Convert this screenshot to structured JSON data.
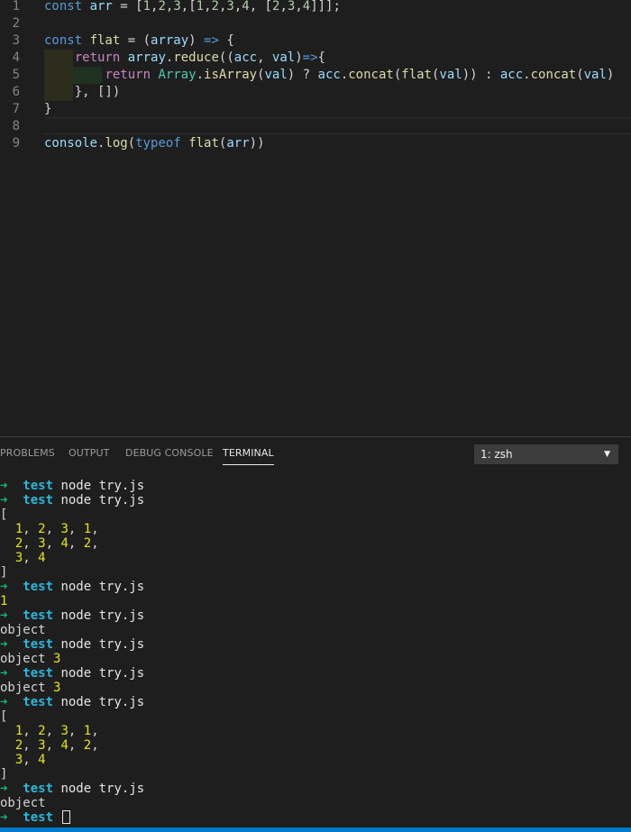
{
  "editor": {
    "lines": [
      {
        "num": "1",
        "tokens": [
          [
            "kw",
            "const "
          ],
          [
            "var",
            "arr"
          ],
          [
            "pl",
            " = ["
          ],
          [
            "num",
            "1"
          ],
          [
            "pl",
            ","
          ],
          [
            "num",
            "2"
          ],
          [
            "pl",
            ","
          ],
          [
            "num",
            "3"
          ],
          [
            "pl",
            ",["
          ],
          [
            "num",
            "1"
          ],
          [
            "pl",
            ","
          ],
          [
            "num",
            "2"
          ],
          [
            "pl",
            ","
          ],
          [
            "num",
            "3"
          ],
          [
            "pl",
            ","
          ],
          [
            "num",
            "4"
          ],
          [
            "pl",
            ", ["
          ],
          [
            "num",
            "2"
          ],
          [
            "pl",
            ","
          ],
          [
            "num",
            "3"
          ],
          [
            "pl",
            ","
          ],
          [
            "num",
            "4"
          ],
          [
            "pl",
            "]]];"
          ]
        ]
      },
      {
        "num": "2",
        "tokens": []
      },
      {
        "num": "3",
        "tokens": [
          [
            "kw",
            "const "
          ],
          [
            "fn",
            "flat"
          ],
          [
            "pl",
            " = ("
          ],
          [
            "var",
            "array"
          ],
          [
            "pl",
            ") "
          ],
          [
            "kw",
            "=>"
          ],
          [
            "pl",
            " {"
          ]
        ]
      },
      {
        "num": "4",
        "tokens": [
          [
            "pl",
            "    "
          ],
          [
            "ctl",
            "return "
          ],
          [
            "var",
            "array"
          ],
          [
            "pl",
            "."
          ],
          [
            "fn",
            "reduce"
          ],
          [
            "pl",
            "(("
          ],
          [
            "var",
            "acc"
          ],
          [
            "pl",
            ", "
          ],
          [
            "var",
            "val"
          ],
          [
            "pl",
            ")"
          ],
          [
            "kw",
            "=>"
          ],
          [
            "pl",
            "{"
          ]
        ]
      },
      {
        "num": "5",
        "tokens": [
          [
            "pl",
            "        "
          ],
          [
            "ctl",
            "return "
          ],
          [
            "cls",
            "Array"
          ],
          [
            "pl",
            "."
          ],
          [
            "fn",
            "isArray"
          ],
          [
            "pl",
            "("
          ],
          [
            "var",
            "val"
          ],
          [
            "pl",
            ") ? "
          ],
          [
            "var",
            "acc"
          ],
          [
            "pl",
            "."
          ],
          [
            "fn",
            "concat"
          ],
          [
            "pl",
            "("
          ],
          [
            "fn",
            "flat"
          ],
          [
            "pl",
            "("
          ],
          [
            "var",
            "val"
          ],
          [
            "pl",
            ")) : "
          ],
          [
            "var",
            "acc"
          ],
          [
            "pl",
            "."
          ],
          [
            "fn",
            "concat"
          ],
          [
            "pl",
            "("
          ],
          [
            "var",
            "val"
          ],
          [
            "pl",
            ")"
          ]
        ]
      },
      {
        "num": "6",
        "tokens": [
          [
            "pl",
            "    }, [])"
          ]
        ]
      },
      {
        "num": "7",
        "tokens": [
          [
            "pl",
            "}"
          ]
        ]
      },
      {
        "num": "8",
        "tokens": []
      },
      {
        "num": "9",
        "tokens": [
          [
            "var",
            "console"
          ],
          [
            "pl",
            "."
          ],
          [
            "fn",
            "log"
          ],
          [
            "pl",
            "("
          ],
          [
            "kw",
            "typeof "
          ],
          [
            "fn",
            "flat"
          ],
          [
            "pl",
            "("
          ],
          [
            "var",
            "arr"
          ],
          [
            "pl",
            "))"
          ]
        ]
      }
    ]
  },
  "panel": {
    "tabs": [
      "PROBLEMS",
      "OUTPUT",
      "DEBUG CONSOLE",
      "TERMINAL"
    ],
    "active_tab": "TERMINAL",
    "terminal_select": "1: zsh"
  },
  "terminal": {
    "prompt_arrow": "➜",
    "prompt_dir": "test",
    "lines": [
      {
        "type": "prompt",
        "cmd": "node try.js"
      },
      {
        "type": "prompt",
        "cmd": "node try.js"
      },
      {
        "type": "out",
        "parts": [
          [
            "pl",
            "["
          ]
        ]
      },
      {
        "type": "out",
        "parts": [
          [
            "pl",
            "  "
          ],
          [
            "yl",
            "1"
          ],
          [
            "pl",
            ", "
          ],
          [
            "yl",
            "2"
          ],
          [
            "pl",
            ", "
          ],
          [
            "yl",
            "3"
          ],
          [
            "pl",
            ", "
          ],
          [
            "yl",
            "1"
          ],
          [
            "pl",
            ","
          ]
        ]
      },
      {
        "type": "out",
        "parts": [
          [
            "pl",
            "  "
          ],
          [
            "yl",
            "2"
          ],
          [
            "pl",
            ", "
          ],
          [
            "yl",
            "3"
          ],
          [
            "pl",
            ", "
          ],
          [
            "yl",
            "4"
          ],
          [
            "pl",
            ", "
          ],
          [
            "yl",
            "2"
          ],
          [
            "pl",
            ","
          ]
        ]
      },
      {
        "type": "out",
        "parts": [
          [
            "pl",
            "  "
          ],
          [
            "yl",
            "3"
          ],
          [
            "pl",
            ", "
          ],
          [
            "yl",
            "4"
          ]
        ]
      },
      {
        "type": "out",
        "parts": [
          [
            "pl",
            "]"
          ]
        ]
      },
      {
        "type": "prompt",
        "cmd": "node try.js"
      },
      {
        "type": "out",
        "parts": [
          [
            "yl",
            "1"
          ]
        ]
      },
      {
        "type": "prompt",
        "cmd": "node try.js"
      },
      {
        "type": "out",
        "parts": [
          [
            "pl",
            "object"
          ]
        ]
      },
      {
        "type": "prompt",
        "cmd": "node try.js"
      },
      {
        "type": "out",
        "parts": [
          [
            "pl",
            "object "
          ],
          [
            "yl",
            "3"
          ]
        ]
      },
      {
        "type": "prompt",
        "cmd": "node try.js"
      },
      {
        "type": "out",
        "parts": [
          [
            "pl",
            "object "
          ],
          [
            "yl",
            "3"
          ]
        ]
      },
      {
        "type": "prompt",
        "cmd": "node try.js"
      },
      {
        "type": "out",
        "parts": [
          [
            "pl",
            "["
          ]
        ]
      },
      {
        "type": "out",
        "parts": [
          [
            "pl",
            "  "
          ],
          [
            "yl",
            "1"
          ],
          [
            "pl",
            ", "
          ],
          [
            "yl",
            "2"
          ],
          [
            "pl",
            ", "
          ],
          [
            "yl",
            "3"
          ],
          [
            "pl",
            ", "
          ],
          [
            "yl",
            "1"
          ],
          [
            "pl",
            ","
          ]
        ]
      },
      {
        "type": "out",
        "parts": [
          [
            "pl",
            "  "
          ],
          [
            "yl",
            "2"
          ],
          [
            "pl",
            ", "
          ],
          [
            "yl",
            "3"
          ],
          [
            "pl",
            ", "
          ],
          [
            "yl",
            "4"
          ],
          [
            "pl",
            ", "
          ],
          [
            "yl",
            "2"
          ],
          [
            "pl",
            ","
          ]
        ]
      },
      {
        "type": "out",
        "parts": [
          [
            "pl",
            "  "
          ],
          [
            "yl",
            "3"
          ],
          [
            "pl",
            ", "
          ],
          [
            "yl",
            "4"
          ]
        ]
      },
      {
        "type": "out",
        "parts": [
          [
            "pl",
            "]"
          ]
        ]
      },
      {
        "type": "prompt",
        "cmd": "node try.js"
      },
      {
        "type": "out",
        "parts": [
          [
            "pl",
            "object"
          ]
        ]
      },
      {
        "type": "prompt",
        "cmd": "",
        "cursor": true
      }
    ]
  }
}
